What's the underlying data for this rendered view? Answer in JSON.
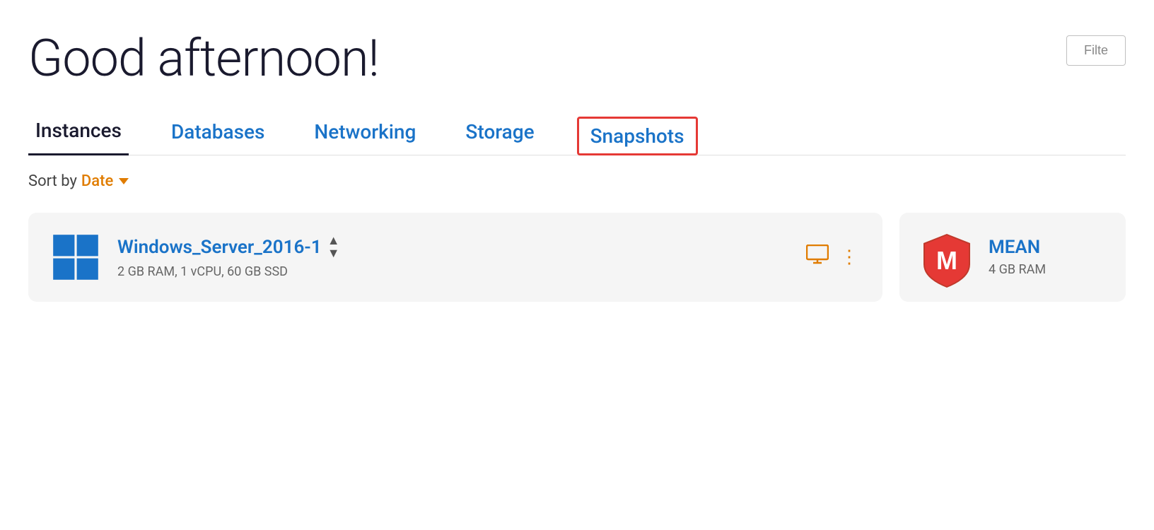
{
  "header": {
    "greeting": "Good afternoon!",
    "filter_label": "Filte"
  },
  "tabs": [
    {
      "id": "instances",
      "label": "Instances",
      "active": true,
      "highlighted": false
    },
    {
      "id": "databases",
      "label": "Databases",
      "active": false,
      "highlighted": false
    },
    {
      "id": "networking",
      "label": "Networking",
      "active": false,
      "highlighted": false
    },
    {
      "id": "storage",
      "label": "Storage",
      "active": false,
      "highlighted": false
    },
    {
      "id": "snapshots",
      "label": "Snapshots",
      "active": false,
      "highlighted": true
    }
  ],
  "sort": {
    "label": "Sort by",
    "value": "Date"
  },
  "instances": [
    {
      "id": "windows-server",
      "name": "Windows_Server_2016-1",
      "specs": "2 GB RAM, 1 vCPU, 60 GB SSD",
      "logo_type": "windows"
    },
    {
      "id": "mean-stack",
      "name": "MEAN",
      "specs": "4 GB RAM",
      "logo_type": "mean"
    }
  ]
}
